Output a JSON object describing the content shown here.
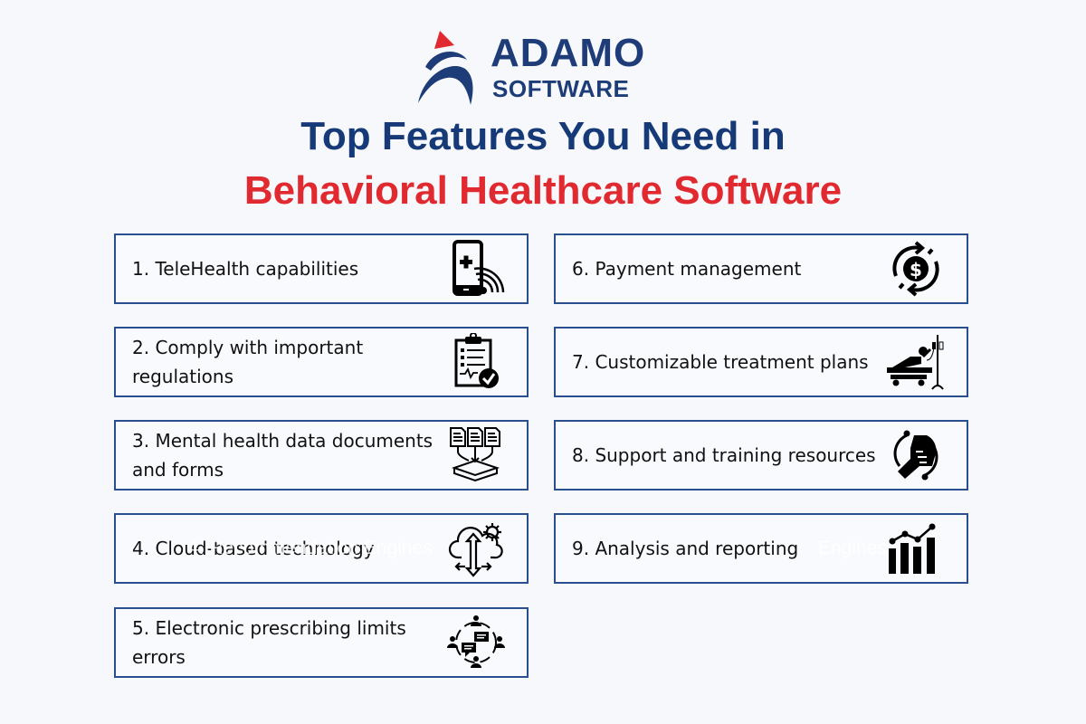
{
  "brand": {
    "name_line1": "ADAMO",
    "name_line2": "SOFTWARE",
    "primary_color": "#1d3c78",
    "accent_color": "#e02a30"
  },
  "header": {
    "title_line1": "Top Features You Need in",
    "title_line2": "Behavioral Healthcare Software"
  },
  "features": [
    {
      "label": "1. TeleHealth capabilities",
      "icon": "telehealth-phone-icon"
    },
    {
      "label": "2. Comply with important regulations",
      "icon": "clipboard-check-icon"
    },
    {
      "label": "3. Mental health data documents and forms",
      "icon": "documents-inbox-icon"
    },
    {
      "label": "4. Cloud-based technology",
      "icon": "cloud-gear-icon",
      "ghost_text": "4. Recommendation Engines"
    },
    {
      "label": "5. Electronic prescribing limits errors",
      "icon": "team-communication-icon"
    },
    {
      "label": "6. Payment management",
      "icon": "payment-cycle-icon"
    },
    {
      "label": "7. Customizable treatment plans",
      "icon": "hospital-bed-iv-icon"
    },
    {
      "label": "8. Support and training resources",
      "icon": "helping-hand-icon"
    },
    {
      "label": "9. Analysis and reporting",
      "icon": "bar-chart-trend-icon",
      "ghost_text": "Engines"
    }
  ]
}
